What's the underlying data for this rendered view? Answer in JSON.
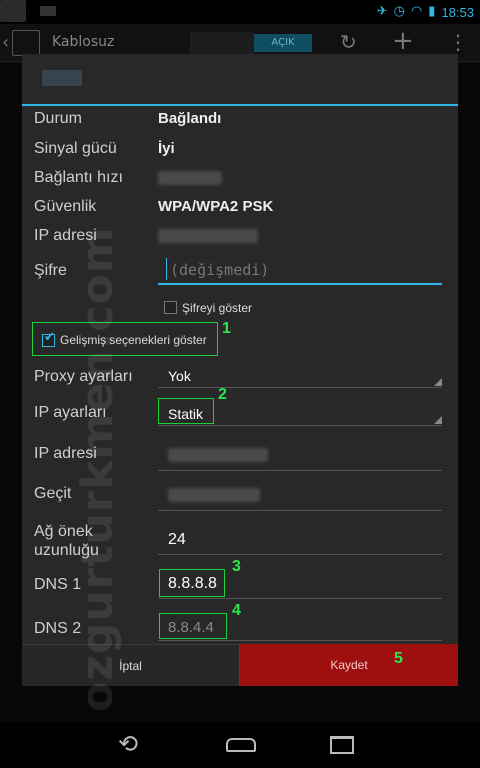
{
  "status_bar": {
    "time": "18:53"
  },
  "app_bar": {
    "title": "Kablosuz",
    "toggle_label": "AÇIK"
  },
  "dialog": {
    "rows": {
      "status": {
        "label": "Durum",
        "value": "Bağlandı"
      },
      "signal": {
        "label": "Sinyal gücü",
        "value": "İyi"
      },
      "speed": {
        "label": "Bağlantı hızı"
      },
      "security": {
        "label": "Güvenlik",
        "value": "WPA/WPA2 PSK"
      },
      "ip_info": {
        "label": "IP adresi"
      },
      "password": {
        "label": "Şifre",
        "placeholder": "(değişmedi)"
      }
    },
    "show_password": {
      "label": "Şifreyi göster",
      "checked": false
    },
    "advanced": {
      "label": "Gelişmiş seçenekleri göster",
      "checked": true
    },
    "proxy": {
      "label": "Proxy ayarları",
      "value": "Yok"
    },
    "ip_settings": {
      "label": "IP ayarları",
      "value": "Statik"
    },
    "ip_address": {
      "label": "IP adresi"
    },
    "gateway": {
      "label": "Geçit"
    },
    "prefix": {
      "label": "Ağ önek uzunluğu",
      "value": "24"
    },
    "dns1": {
      "label": "DNS 1",
      "value": "8.8.8.8"
    },
    "dns2": {
      "label": "DNS 2",
      "value": "8.8.4.4"
    },
    "buttons": {
      "cancel": "İptal",
      "save": "Kaydet"
    }
  },
  "annotations": [
    "1",
    "2",
    "3",
    "4",
    "5"
  ],
  "watermark": "ozgurturkmen.com",
  "colors": {
    "accent": "#33b5e5",
    "highlight": "#2de64a",
    "save_button": "#9e1010"
  }
}
